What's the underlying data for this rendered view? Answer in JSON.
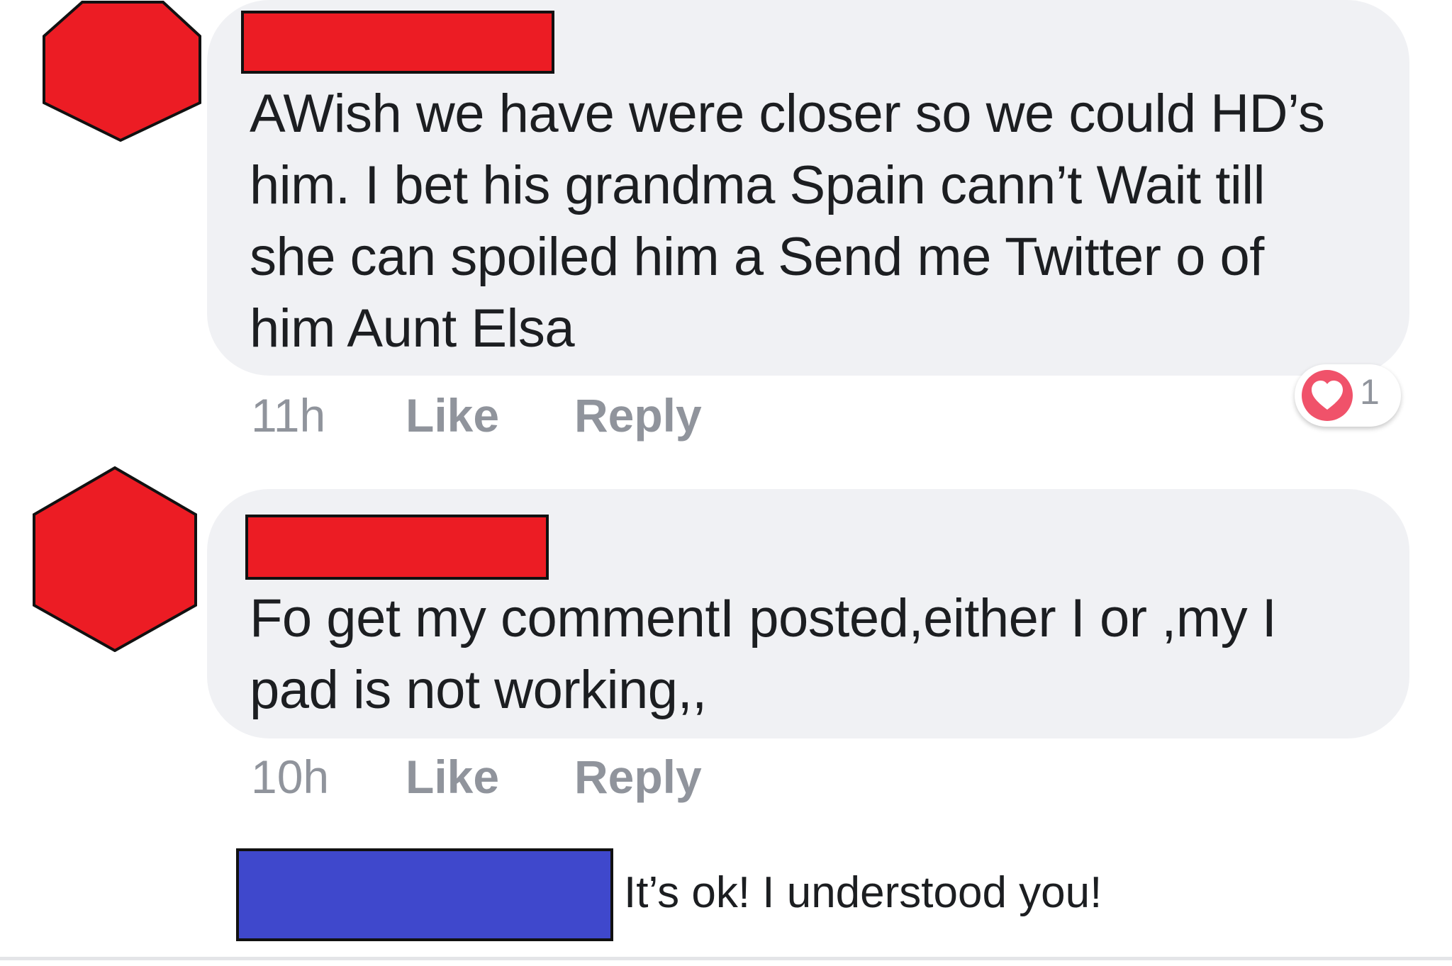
{
  "comments": [
    {
      "text_lines": [
        "AWish we have were closer so we could HD’s",
        "him. I bet his grandma Spain cann’t Wait till",
        "she can spoiled him a Send me Twitter o of",
        "him Aunt Elsa"
      ],
      "time": "11h",
      "like_label": "Like",
      "reply_label": "Reply",
      "reaction": {
        "icon": "heart-icon",
        "count": "1"
      }
    },
    {
      "text_lines": [
        "Fo get my commentI posted,either I or ,my I",
        "pad is not working,,"
      ],
      "time": "10h",
      "like_label": "Like",
      "reply_label": "Reply"
    }
  ],
  "reply_preview": {
    "text": "It’s ok! I understood you!"
  },
  "colors": {
    "avatar_redaction": "#ec1c24",
    "name_redaction": "#ec1c24",
    "reply_name_redaction": "#3f48cc",
    "bubble": "#f0f1f4",
    "meta_text": "#90949c",
    "heart": "#f0526a"
  }
}
